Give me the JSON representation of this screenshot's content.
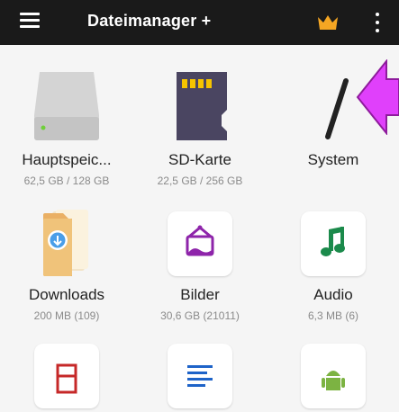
{
  "header": {
    "title": "Dateimanager +",
    "crown_color": "#f5a623"
  },
  "storage": [
    {
      "name": "Hauptspeic...",
      "info": "62,5 GB / 128 GB",
      "icon": "internal-storage-icon"
    },
    {
      "name": "SD-Karte",
      "info": "22,5 GB / 256 GB",
      "icon": "sd-card-icon"
    },
    {
      "name": "System",
      "info": "",
      "icon": "root-slash-icon"
    }
  ],
  "categories": [
    {
      "name": "Downloads",
      "info": "200 MB (109)",
      "icon": "downloads-folder-icon"
    },
    {
      "name": "Bilder",
      "info": "30,6 GB (21011)",
      "icon": "pictures-icon"
    },
    {
      "name": "Audio",
      "info": "6,3 MB (6)",
      "icon": "music-note-icon"
    }
  ],
  "partial_row": [
    {
      "icon": "video-film-icon"
    },
    {
      "icon": "document-lines-icon"
    },
    {
      "icon": "android-icon"
    }
  ],
  "colors": {
    "topbar": "#1a1a1a",
    "accent_purple": "#8e24aa",
    "accent_green": "#1b8a4b",
    "arrow_magenta": "#e040fb"
  }
}
